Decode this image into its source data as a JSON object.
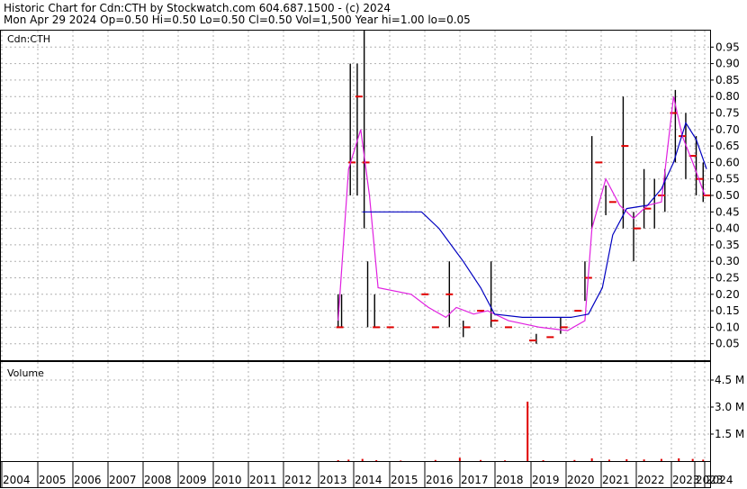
{
  "header": {
    "line1": "Historic Chart for Cdn:CTH by Stockwatch.com 604.687.1500 - (c) 2024",
    "line2": "Mon Apr 29 2024  Op=0.50  Hi=0.50  Lo=0.50  Cl=0.50  Vol=1,500  Year hi=1.00  lo=0.05"
  },
  "colors": {
    "price": "#000000",
    "close_marks": "#e00000",
    "ma_short": "#e020e0",
    "ma_long": "#0000c0",
    "volume": "#e00000",
    "grid": "#b0b0b0"
  },
  "chart_data": [
    {
      "type": "line",
      "title": "Cdn:CTH",
      "ylim": [
        0.0,
        1.0
      ],
      "y_ticks": [
        "0.95",
        "0.90",
        "0.85",
        "0.80",
        "0.75",
        "0.70",
        "0.65",
        "0.60",
        "0.55",
        "0.50",
        "0.45",
        "0.40",
        "0.35",
        "0.30",
        "0.25",
        "0.20",
        "0.15",
        "0.10",
        "0.05"
      ],
      "x_ticks": [
        "2004",
        "2005",
        "2006",
        "2007",
        "2008",
        "2009",
        "2010",
        "2011",
        "2012",
        "2013",
        "2014",
        "2015",
        "2016",
        "2017",
        "2018",
        "2019",
        "2020",
        "2021",
        "2022",
        "2023",
        "2023",
        "2024"
      ],
      "price_bars": [
        {
          "x": 2013.7,
          "low": 0.1,
          "high": 0.2
        },
        {
          "x": 2013.8,
          "low": 0.1,
          "high": 0.2
        },
        {
          "x": 2014.05,
          "low": 0.5,
          "high": 0.9
        },
        {
          "x": 2014.25,
          "low": 0.5,
          "high": 0.9
        },
        {
          "x": 2014.45,
          "low": 0.4,
          "high": 1.0
        },
        {
          "x": 2014.55,
          "low": 0.1,
          "high": 0.3
        },
        {
          "x": 2014.75,
          "low": 0.1,
          "high": 0.2
        },
        {
          "x": 2016.9,
          "low": 0.1,
          "high": 0.3
        },
        {
          "x": 2017.3,
          "low": 0.07,
          "high": 0.12
        },
        {
          "x": 2018.1,
          "low": 0.1,
          "high": 0.3
        },
        {
          "x": 2019.4,
          "low": 0.05,
          "high": 0.08
        },
        {
          "x": 2020.1,
          "low": 0.08,
          "high": 0.13
        },
        {
          "x": 2020.8,
          "low": 0.18,
          "high": 0.3
        },
        {
          "x": 2021.0,
          "low": 0.4,
          "high": 0.68
        },
        {
          "x": 2021.4,
          "low": 0.44,
          "high": 0.53
        },
        {
          "x": 2021.9,
          "low": 0.4,
          "high": 0.8
        },
        {
          "x": 2022.2,
          "low": 0.3,
          "high": 0.45
        },
        {
          "x": 2022.5,
          "low": 0.4,
          "high": 0.58
        },
        {
          "x": 2022.8,
          "low": 0.4,
          "high": 0.55
        },
        {
          "x": 2023.1,
          "low": 0.45,
          "high": 0.58
        },
        {
          "x": 2023.4,
          "low": 0.6,
          "high": 0.82
        },
        {
          "x": 2023.7,
          "low": 0.55,
          "high": 0.75
        },
        {
          "x": 2024.0,
          "low": 0.5,
          "high": 0.68
        },
        {
          "x": 2024.2,
          "low": 0.48,
          "high": 0.6
        }
      ],
      "close_points": [
        {
          "x": 2013.75,
          "y": 0.1
        },
        {
          "x": 2014.1,
          "y": 0.6
        },
        {
          "x": 2014.3,
          "y": 0.8
        },
        {
          "x": 2014.5,
          "y": 0.6
        },
        {
          "x": 2014.8,
          "y": 0.1
        },
        {
          "x": 2015.2,
          "y": 0.1
        },
        {
          "x": 2016.2,
          "y": 0.2
        },
        {
          "x": 2016.5,
          "y": 0.1
        },
        {
          "x": 2016.9,
          "y": 0.2
        },
        {
          "x": 2017.4,
          "y": 0.1
        },
        {
          "x": 2017.8,
          "y": 0.15
        },
        {
          "x": 2018.2,
          "y": 0.12
        },
        {
          "x": 2018.6,
          "y": 0.1
        },
        {
          "x": 2019.3,
          "y": 0.06
        },
        {
          "x": 2019.8,
          "y": 0.07
        },
        {
          "x": 2020.2,
          "y": 0.1
        },
        {
          "x": 2020.6,
          "y": 0.15
        },
        {
          "x": 2020.9,
          "y": 0.25
        },
        {
          "x": 2021.2,
          "y": 0.6
        },
        {
          "x": 2021.6,
          "y": 0.48
        },
        {
          "x": 2021.95,
          "y": 0.65
        },
        {
          "x": 2022.3,
          "y": 0.4
        },
        {
          "x": 2022.6,
          "y": 0.46
        },
        {
          "x": 2023.0,
          "y": 0.5
        },
        {
          "x": 2023.35,
          "y": 0.75
        },
        {
          "x": 2023.6,
          "y": 0.68
        },
        {
          "x": 2023.9,
          "y": 0.62
        },
        {
          "x": 2024.1,
          "y": 0.55
        },
        {
          "x": 2024.3,
          "y": 0.5
        }
      ],
      "series": [
        {
          "values": [
            [
              2013.7,
              0.12
            ],
            [
              2014.0,
              0.58
            ],
            [
              2014.35,
              0.7
            ],
            [
              2014.6,
              0.5
            ],
            [
              2014.85,
              0.22
            ],
            [
              2015.8,
              0.2
            ],
            [
              2016.3,
              0.16
            ],
            [
              2016.8,
              0.13
            ],
            [
              2017.1,
              0.16
            ],
            [
              2017.6,
              0.14
            ],
            [
              2018.0,
              0.15
            ],
            [
              2018.6,
              0.12
            ],
            [
              2019.5,
              0.1
            ],
            [
              2020.3,
              0.09
            ],
            [
              2020.8,
              0.12
            ],
            [
              2021.0,
              0.4
            ],
            [
              2021.4,
              0.55
            ],
            [
              2021.8,
              0.47
            ],
            [
              2022.2,
              0.43
            ],
            [
              2022.6,
              0.47
            ],
            [
              2023.0,
              0.48
            ],
            [
              2023.35,
              0.8
            ],
            [
              2023.6,
              0.68
            ],
            [
              2023.9,
              0.6
            ],
            [
              2024.25,
              0.5
            ]
          ]
        },
        {
          "values": [
            [
              2014.4,
              0.45
            ],
            [
              2014.9,
              0.45
            ],
            [
              2016.1,
              0.45
            ],
            [
              2016.6,
              0.4
            ],
            [
              2017.3,
              0.3
            ],
            [
              2017.8,
              0.22
            ],
            [
              2018.2,
              0.14
            ],
            [
              2019.0,
              0.13
            ],
            [
              2020.4,
              0.13
            ],
            [
              2020.9,
              0.14
            ],
            [
              2021.3,
              0.22
            ],
            [
              2021.6,
              0.38
            ],
            [
              2022.0,
              0.46
            ],
            [
              2022.6,
              0.47
            ],
            [
              2023.0,
              0.52
            ],
            [
              2023.35,
              0.6
            ],
            [
              2023.7,
              0.72
            ],
            [
              2024.0,
              0.67
            ],
            [
              2024.3,
              0.58
            ]
          ]
        }
      ]
    },
    {
      "type": "bar",
      "title": "Volume",
      "ylim": [
        0,
        5.5
      ],
      "y_ticks": [
        "4.5 M",
        "3.0 M",
        "1.5 M"
      ],
      "values": [
        [
          2013.7,
          0.05
        ],
        [
          2014.0,
          0.08
        ],
        [
          2014.4,
          0.12
        ],
        [
          2014.8,
          0.05
        ],
        [
          2015.5,
          0.03
        ],
        [
          2016.5,
          0.06
        ],
        [
          2017.2,
          0.18
        ],
        [
          2017.8,
          0.06
        ],
        [
          2018.5,
          0.04
        ],
        [
          2019.15,
          3.3
        ],
        [
          2019.6,
          0.05
        ],
        [
          2020.5,
          0.06
        ],
        [
          2021.0,
          0.15
        ],
        [
          2021.5,
          0.08
        ],
        [
          2022.0,
          0.1
        ],
        [
          2022.5,
          0.09
        ],
        [
          2023.0,
          0.12
        ],
        [
          2023.5,
          0.15
        ],
        [
          2023.9,
          0.12
        ],
        [
          2024.2,
          0.08
        ]
      ]
    }
  ]
}
